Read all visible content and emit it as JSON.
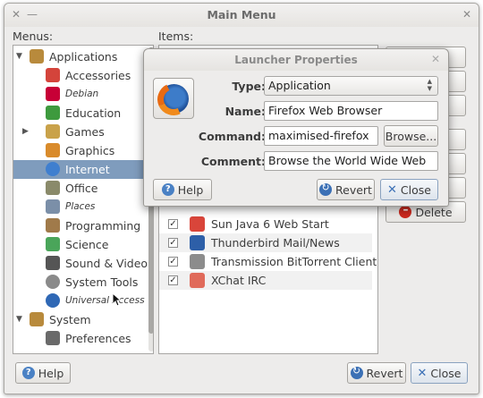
{
  "main_window": {
    "title": "Main Menu",
    "menus_label": "Menus:",
    "items_label": "Items:",
    "menus": [
      {
        "label": "Applications",
        "icon": "applications-folder-icon",
        "level": 0,
        "expanded": true,
        "color": "#b88a3c"
      },
      {
        "label": "Accessories",
        "icon": "accessories-icon",
        "level": 1,
        "color": "#d4443b"
      },
      {
        "label": "Debian",
        "icon": "debian-icon",
        "level": 1,
        "italic": true,
        "color": "#c70036"
      },
      {
        "label": "Education",
        "icon": "education-icon",
        "level": 1,
        "color": "#3e9a3e"
      },
      {
        "label": "Games",
        "icon": "games-icon",
        "level": 1,
        "collapsed": true,
        "color": "#c9a24a"
      },
      {
        "label": "Graphics",
        "icon": "graphics-icon",
        "level": 1,
        "color": "#d98b2b"
      },
      {
        "label": "Internet",
        "icon": "internet-globe-icon",
        "level": 1,
        "selected": true,
        "color": "#3f7fcf"
      },
      {
        "label": "Office",
        "icon": "office-icon",
        "level": 1,
        "color": "#8a8a6a"
      },
      {
        "label": "Places",
        "icon": "places-icon",
        "level": 1,
        "italic": true,
        "color": "#7b8fa8"
      },
      {
        "label": "Programming",
        "icon": "programming-icon",
        "level": 1,
        "color": "#a07a4a"
      },
      {
        "label": "Science",
        "icon": "science-icon",
        "level": 1,
        "color": "#4aa55a"
      },
      {
        "label": "Sound & Video",
        "icon": "sound-video-icon",
        "level": 1,
        "color": "#555555"
      },
      {
        "label": "System Tools",
        "icon": "system-tools-icon",
        "level": 1,
        "color": "#8a8a8a"
      },
      {
        "label": "Universal Access",
        "icon": "universal-access-icon",
        "level": 1,
        "italic": true,
        "color": "#2f68b5"
      },
      {
        "label": "System",
        "icon": "system-folder-icon",
        "level": 0,
        "expanded": true,
        "color": "#b88a3c"
      },
      {
        "label": "Preferences",
        "icon": "preferences-icon",
        "level": 1,
        "color": "#6a6a6a"
      }
    ],
    "items": [
      {
        "label": "Sun Java 6 Web Start",
        "checked": true,
        "icon": "java-icon",
        "color": "#d9453a"
      },
      {
        "label": "Thunderbird Mail/News",
        "checked": true,
        "icon": "thunderbird-icon",
        "color": "#2d5fa8"
      },
      {
        "label": "Transmission BitTorrent Client",
        "checked": true,
        "icon": "transmission-icon",
        "color": "#8c8c8c"
      },
      {
        "label": "XChat IRC",
        "checked": true,
        "icon": "xchat-icon",
        "color": "#e06a5a"
      }
    ],
    "right_buttons": {
      "delete": "Delete"
    },
    "footer": {
      "help": "Help",
      "revert": "Revert",
      "close": "Close"
    }
  },
  "dialog": {
    "title": "Launcher Properties",
    "type_label": "Type:",
    "type_value": "Application",
    "name_label": "Name:",
    "name_value": "Firefox Web Browser",
    "command_label": "Command:",
    "command_value": "maximised-firefox",
    "browse_label": "Browse...",
    "comment_label": "Comment:",
    "comment_value": "Browse the World Wide Web",
    "help": "Help",
    "revert": "Revert",
    "close": "Close"
  }
}
